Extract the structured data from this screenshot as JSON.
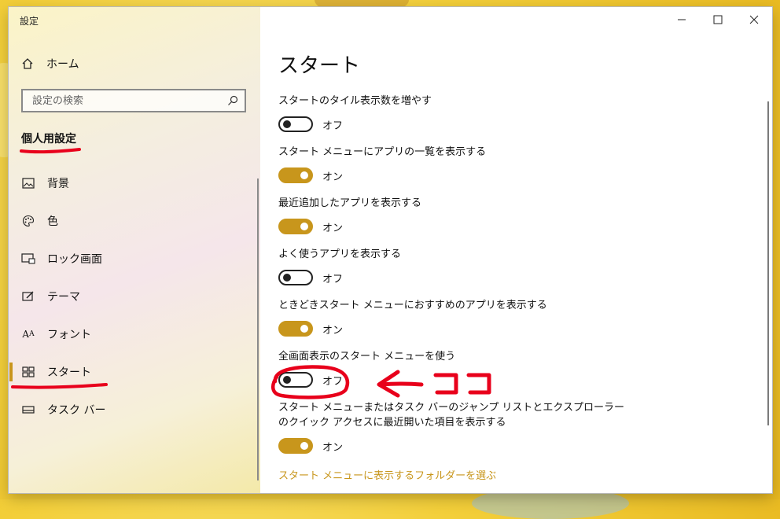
{
  "window": {
    "title": "設定"
  },
  "sidebar": {
    "home_label": "ホーム",
    "search_placeholder": "設定の検索",
    "section_title": "個人用設定",
    "items": [
      {
        "label": "背景",
        "icon": "picture-icon"
      },
      {
        "label": "色",
        "icon": "palette-icon"
      },
      {
        "label": "ロック画面",
        "icon": "lock-screen-icon"
      },
      {
        "label": "テーマ",
        "icon": "theme-icon"
      },
      {
        "label": "フォント",
        "icon": "font-icon"
      },
      {
        "label": "スタート",
        "icon": "start-icon",
        "active": true
      },
      {
        "label": "タスク バー",
        "icon": "taskbar-icon"
      }
    ]
  },
  "main": {
    "title": "スタート",
    "settings": [
      {
        "label": "スタートのタイル表示数を増やす",
        "state": "オフ",
        "on": false
      },
      {
        "label": "スタート メニューにアプリの一覧を表示する",
        "state": "オン",
        "on": true
      },
      {
        "label": "最近追加したアプリを表示する",
        "state": "オン",
        "on": true
      },
      {
        "label": "よく使うアプリを表示する",
        "state": "オフ",
        "on": false
      },
      {
        "label": "ときどきスタート メニューにおすすめのアプリを表示する",
        "state": "オン",
        "on": true
      },
      {
        "label": "全画面表示のスタート メニューを使う",
        "state": "オフ",
        "on": false
      },
      {
        "label": "スタート メニューまたはタスク バーのジャンプ リストとエクスプローラーのクイック アクセスに最近開いた項目を表示する",
        "state": "オン",
        "on": true
      }
    ],
    "folder_link": "スタート メニューに表示するフォルダーを選ぶ"
  },
  "colors": {
    "accent": "#c8961c",
    "annotation": "#e8001b"
  }
}
